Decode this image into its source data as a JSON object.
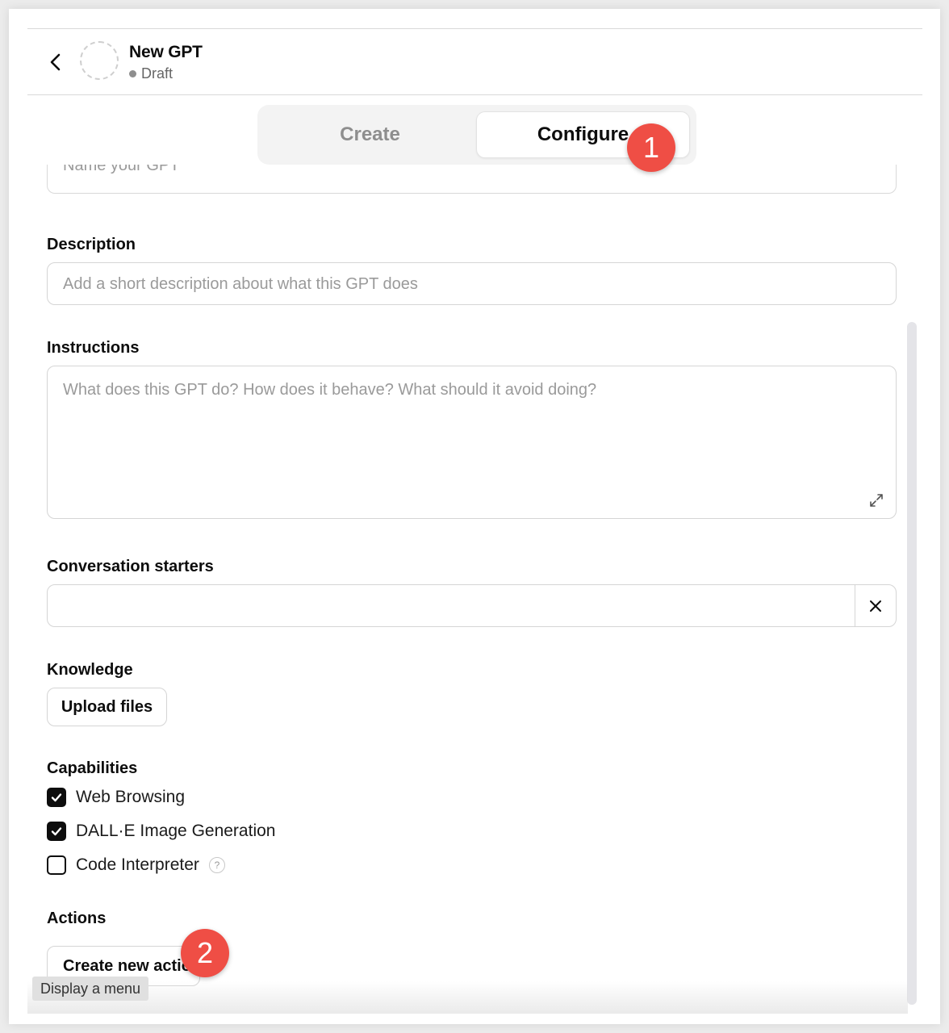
{
  "header": {
    "title": "New GPT",
    "status": "Draft"
  },
  "tabs": [
    {
      "label": "Create",
      "active": false
    },
    {
      "label": "Configure",
      "active": true
    }
  ],
  "annotations": [
    "1",
    "2"
  ],
  "fields": {
    "name_placeholder": "Name your GPT",
    "description_label": "Description",
    "description_placeholder": "Add a short description about what this GPT does",
    "instructions_label": "Instructions",
    "instructions_placeholder": "What does this GPT do? How does it behave? What should it avoid doing?",
    "starters_label": "Conversation starters",
    "starters_value": ""
  },
  "knowledge": {
    "label": "Knowledge",
    "upload_label": "Upload files"
  },
  "capabilities": {
    "label": "Capabilities",
    "items": [
      {
        "label": "Web Browsing",
        "checked": true
      },
      {
        "label": "DALL·E Image Generation",
        "checked": true
      },
      {
        "label": "Code Interpreter",
        "checked": false,
        "help": "?"
      }
    ]
  },
  "actions": {
    "label": "Actions",
    "button_label": "Create new action"
  },
  "tooltip": "Display a menu",
  "colors": {
    "badge": "#ef4e45",
    "tab_bg": "#f3f3f3",
    "text": "#0d0d0d",
    "muted": "#9a9a9a"
  }
}
